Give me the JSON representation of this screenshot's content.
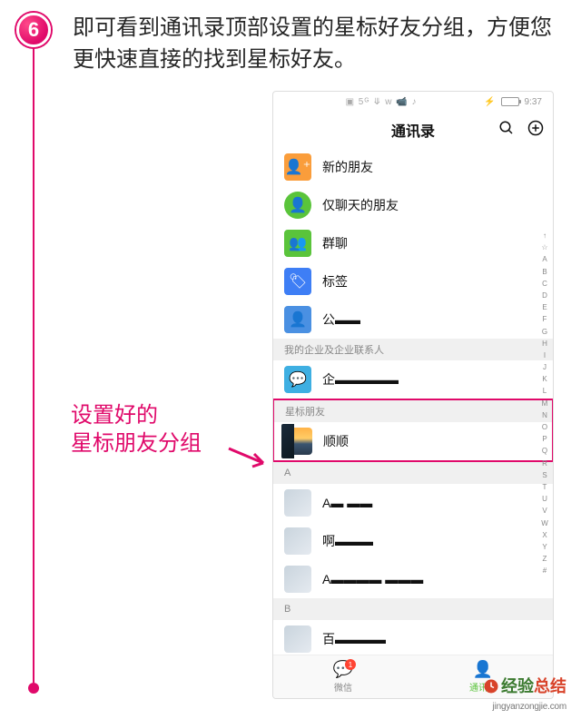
{
  "step": {
    "number": "6"
  },
  "instruction": "即可看到通讯录顶部设置的星标好友分组，方便您更快速直接的找到星标好友。",
  "callout": {
    "line1": "设置好的",
    "line2": "星标朋友分组"
  },
  "statusbar": {
    "icons": "▣ 5ᴳ ⤋ ᴡ 📹 ♪",
    "bt": "⚡",
    "time": "9:37"
  },
  "titlebar": {
    "title": "通讯录"
  },
  "menu": {
    "newFriends": "新的朋友",
    "chatOnly": "仅聊天的朋友",
    "groupChats": "群聊",
    "tags": "标签",
    "official": "公"
  },
  "sections": {
    "enterpriseHead": "我的企业及企业联系人",
    "enterpriseItem": "企",
    "starHead": "星标朋友",
    "starContact": "顺顺",
    "a": "A",
    "a1": "A",
    "a2": "啊",
    "a3": "A",
    "b": "B",
    "b1": "百"
  },
  "index": [
    "↑",
    "☆",
    "A",
    "B",
    "C",
    "D",
    "E",
    "F",
    "G",
    "H",
    "I",
    "J",
    "K",
    "L",
    "M",
    "N",
    "O",
    "P",
    "Q",
    "R",
    "S",
    "T",
    "U",
    "V",
    "W",
    "X",
    "Y",
    "Z",
    "#"
  ],
  "bottomnav": {
    "wechat": "微信",
    "contacts": "通讯录",
    "badge": "1"
  },
  "watermark": {
    "cn1": "经",
    "cn2": "验",
    "cn3": "总",
    "cn4": "结",
    "url": "jingyanzongjie.com"
  }
}
